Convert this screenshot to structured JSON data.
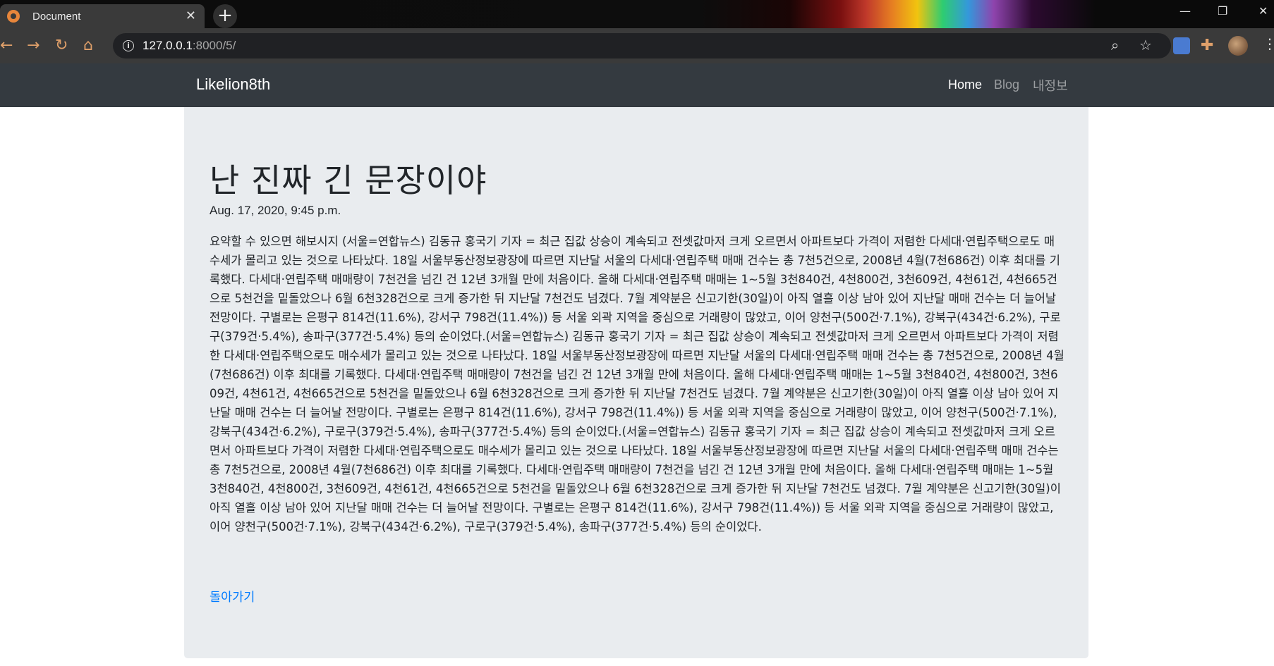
{
  "browser": {
    "tab_title": "Document",
    "tab_close": "✕",
    "new_tab": "+",
    "url_host": "127.0.0.1",
    "url_path": ":8000/5/",
    "icons": [
      "back-arrow-icon",
      "forward-arrow-icon",
      "reload-icon",
      "home-icon",
      "info-icon",
      "zoom-icon",
      "star-icon",
      "translate-icon",
      "extensions-icon",
      "profile-avatar",
      "menu-icon"
    ],
    "window_controls": [
      "—",
      "❐",
      "✕"
    ]
  },
  "navbar": {
    "brand": "Likelion8th",
    "links": [
      {
        "label": "Home",
        "active": true
      },
      {
        "label": "Blog",
        "active": false
      },
      {
        "label": "내정보",
        "active": false
      }
    ]
  },
  "post": {
    "title": "난 진짜 긴 문장이야",
    "date": "Aug. 17, 2020, 9:45 p.m.",
    "body": "요약할 수 있으면 해보시지 (서울=연합뉴스) 김동규 홍국기 기자 = 최근 집값 상승이 계속되고 전셋값마저 크게 오르면서 아파트보다 가격이 저렴한 다세대·연립주택으로도 매수세가 몰리고 있는 것으로 나타났다. 18일 서울부동산정보광장에 따르면 지난달 서울의 다세대·연립주택 매매 건수는 총 7천5건으로, 2008년 4월(7천686건) 이후 최대를 기록했다. 다세대·연립주택 매매량이 7천건을 넘긴 건 12년 3개월 만에 처음이다. 올해 다세대·연립주택 매매는 1~5월 3천840건, 4천800건, 3천609건, 4천61건, 4천665건으로 5천건을 밑돌았으나 6월 6천328건으로 크게 증가한 뒤 지난달 7천건도 넘겼다. 7월 계약분은 신고기한(30일)이 아직 열흘 이상 남아 있어 지난달 매매 건수는 더 늘어날 전망이다. 구별로는 은평구 814건(11.6%), 강서구 798건(11.4%)) 등 서울 외곽 지역을 중심으로 거래량이 많았고, 이어 양천구(500건·7.1%), 강북구(434건·6.2%), 구로구(379건·5.4%), 송파구(377건·5.4%) 등의 순이었다.(서울=연합뉴스) 김동규 홍국기 기자 = 최근 집값 상승이 계속되고 전셋값마저 크게 오르면서 아파트보다 가격이 저렴한 다세대·연립주택으로도 매수세가 몰리고 있는 것으로 나타났다. 18일 서울부동산정보광장에 따르면 지난달 서울의 다세대·연립주택 매매 건수는 총 7천5건으로, 2008년 4월(7천686건) 이후 최대를 기록했다. 다세대·연립주택 매매량이 7천건을 넘긴 건 12년 3개월 만에 처음이다. 올해 다세대·연립주택 매매는 1~5월 3천840건, 4천800건, 3천609건, 4천61건, 4천665건으로 5천건을 밑돌았으나 6월 6천328건으로 크게 증가한 뒤 지난달 7천건도 넘겼다. 7월 계약분은 신고기한(30일)이 아직 열흘 이상 남아 있어 지난달 매매 건수는 더 늘어날 전망이다. 구별로는 은평구 814건(11.6%), 강서구 798건(11.4%)) 등 서울 외곽 지역을 중심으로 거래량이 많았고, 이어 양천구(500건·7.1%), 강북구(434건·6.2%), 구로구(379건·5.4%), 송파구(377건·5.4%) 등의 순이었다.(서울=연합뉴스) 김동규 홍국기 기자 = 최근 집값 상승이 계속되고 전셋값마저 크게 오르면서 아파트보다 가격이 저렴한 다세대·연립주택으로도 매수세가 몰리고 있는 것으로 나타났다. 18일 서울부동산정보광장에 따르면 지난달 서울의 다세대·연립주택 매매 건수는 총 7천5건으로, 2008년 4월(7천686건) 이후 최대를 기록했다. 다세대·연립주택 매매량이 7천건을 넘긴 건 12년 3개월 만에 처음이다. 올해 다세대·연립주택 매매는 1~5월 3천840건, 4천800건, 3천609건, 4천61건, 4천665건으로 5천건을 밑돌았으나 6월 6천328건으로 크게 증가한 뒤 지난달 7천건도 넘겼다. 7월 계약분은 신고기한(30일)이 아직 열흘 이상 남아 있어 지난달 매매 건수는 더 늘어날 전망이다. 구별로는 은평구 814건(11.6%), 강서구 798건(11.4%)) 등 서울 외곽 지역을 중심으로 거래량이 많았고, 이어 양천구(500건·7.1%), 강북구(434건·6.2%), 구로구(379건·5.4%), 송파구(377건·5.4%) 등의 순이었다.",
    "back_link": "돌아가기"
  },
  "colors": {
    "navbar_bg": "#343a40",
    "jumbotron_bg": "#e9ecef",
    "link": "#007bff",
    "text": "#212529"
  }
}
